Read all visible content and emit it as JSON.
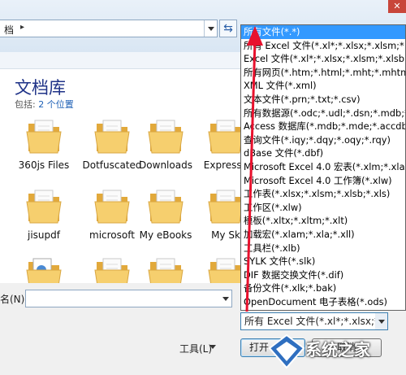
{
  "address_bar": {
    "path_text": "档",
    "separator": "▸"
  },
  "library": {
    "title": "文档库",
    "subtitle_prefix": "包括:",
    "subtitle_link": "2 个位置"
  },
  "files": [
    {
      "name": "360js Files",
      "type": "folder"
    },
    {
      "name": "Dotfuscated",
      "type": "folder"
    },
    {
      "name": "Downloads",
      "type": "folder"
    },
    {
      "name": "Expressn",
      "type": "folder"
    },
    {
      "name": "jisupdf",
      "type": "folder"
    },
    {
      "name": "microsoft",
      "type": "folder"
    },
    {
      "name": "My eBooks",
      "type": "folder"
    },
    {
      "name": "My Sk",
      "type": "folder"
    },
    {
      "name": "",
      "type": "document-folder"
    },
    {
      "name": "",
      "type": "folder"
    },
    {
      "name": "",
      "type": "folder"
    },
    {
      "name": "",
      "type": "folder"
    }
  ],
  "filename": {
    "label": "名(N):",
    "value": ""
  },
  "file_type_filter": {
    "selected": "所有 Excel 文件(*.xl*;*.xlsx;*.xl",
    "options": [
      "所有文件(*.*)",
      "所有 Excel 文件(*.xl*;*.xlsx;*.xlsm;*.xls",
      "Excel 文件(*.xl*;*.xlsx;*.xlsm;*.xlsb;*.x",
      "所有网页(*.htm;*.html;*.mht;*.mhtml)",
      "XML 文件(*.xml)",
      "文本文件(*.prn;*.txt;*.csv)",
      "所有数据源(*.odc;*.udl;*.dsn;*.mdb;*.",
      "Access 数据库(*.mdb;*.mde;*.accdb;",
      "查询文件(*.iqy;*.dqy;*.oqy;*.rqy)",
      "dBase 文件(*.dbf)",
      "Microsoft Excel 4.0 宏表(*.xlm;*.xla)",
      "Microsoft Excel 4.0 工作簿(*.xlw)",
      "工作表(*.xlsx;*.xlsm;*.xlsb;*.xls)",
      "工作区(*.xlw)",
      "模板(*.xltx;*.xltm;*.xlt)",
      "加载宏(*.xlam;*.xla;*.xll)",
      "工具栏(*.xlb)",
      "SYLK 文件(*.slk)",
      "DIF 数据交换文件(*.dif)",
      "备份文件(*.xlk;*.bak)",
      "OpenDocument 电子表格(*.ods)"
    ]
  },
  "buttons": {
    "tools": "工具(L)",
    "open": "打开",
    "cancel": "取消"
  },
  "watermark": {
    "text": "系统之家"
  },
  "colors": {
    "highlight": "#3399ff",
    "annotation_arrow": "#e8112d",
    "folder": "#f2c25c",
    "title": "#1e3287"
  }
}
